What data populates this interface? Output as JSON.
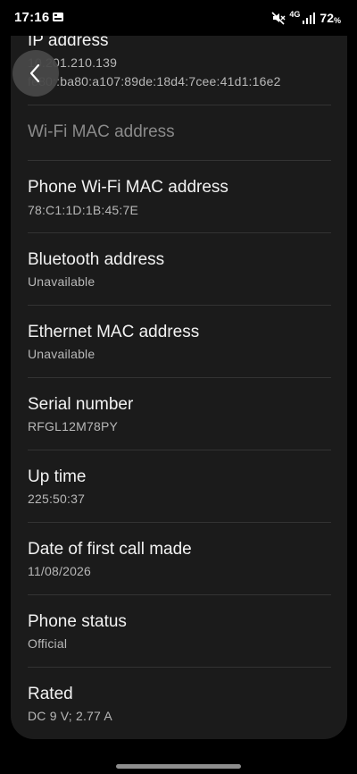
{
  "status_bar": {
    "time": "17:16",
    "network": "4G",
    "battery_percent": "72",
    "battery_symbol": "%",
    "icons": [
      "gallery-notification-icon",
      "mute-icon",
      "signal-icon"
    ]
  },
  "header": {
    "back_icon": "back-arrow-icon"
  },
  "rows": [
    {
      "title": "IP address",
      "values": [
        "10.201.210.139",
        "fe80::ba80:a107:89de:18d4:7cee:41d1:16e2"
      ]
    },
    {
      "title": "Wi-Fi MAC address",
      "values": []
    },
    {
      "title": "Phone Wi-Fi MAC address",
      "values": [
        "78:C1:1D:1B:45:7E"
      ]
    },
    {
      "title": "Bluetooth address",
      "values": [
        "Unavailable"
      ]
    },
    {
      "title": "Ethernet MAC address",
      "values": [
        "Unavailable"
      ]
    },
    {
      "title": "Serial number",
      "values": [
        "RFGL12M78PY"
      ]
    },
    {
      "title": "Up time",
      "values": [
        "225:50:37"
      ]
    },
    {
      "title": "Date of first call made",
      "values": [
        "11/08/2026"
      ]
    },
    {
      "title": "Phone status",
      "values": [
        "Official"
      ]
    },
    {
      "title": "Rated",
      "values": [
        "DC 9 V; 2.77 A"
      ]
    }
  ],
  "colors": {
    "background": "#000000",
    "card": "#1b1b1b",
    "title": "#f2f2f2",
    "value": "#b8b8b8",
    "disabled_title": "#8a8a8a",
    "divider": "#333333"
  }
}
